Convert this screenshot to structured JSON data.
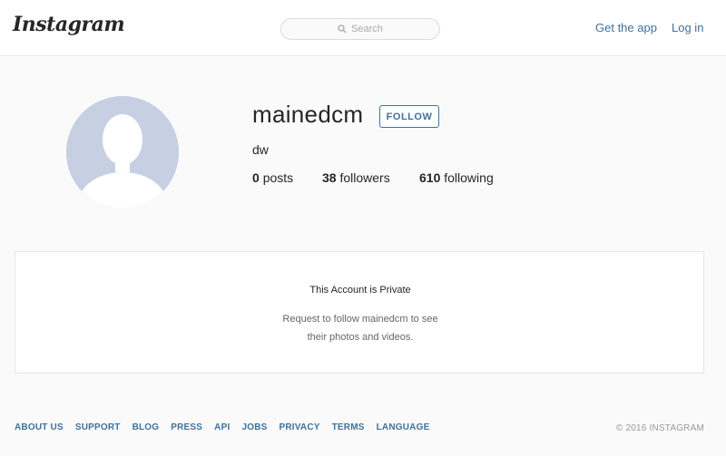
{
  "header": {
    "logo_text": "Instagram",
    "search_placeholder": "Search",
    "get_app_label": "Get the app",
    "login_label": "Log in"
  },
  "profile": {
    "username": "mainedcm",
    "follow_label": "FOLLOW",
    "full_name": "dw",
    "stats": {
      "posts_count": "0",
      "posts_label": "posts",
      "followers_count": "38",
      "followers_label": "followers",
      "following_count": "610",
      "following_label": "following"
    }
  },
  "private_notice": {
    "title": "This Account is Private",
    "line1": "Request to follow mainedcm to see",
    "line2": "their photos and videos."
  },
  "footer": {
    "links": [
      "ABOUT US",
      "SUPPORT",
      "BLOG",
      "PRESS",
      "API",
      "JOBS",
      "PRIVACY",
      "TERMS",
      "LANGUAGE"
    ],
    "copyright": "© 2016 INSTAGRAM"
  },
  "colors": {
    "link_blue": "#3f729b",
    "avatar_bg": "#c7d0e2",
    "page_bg": "#fafafa"
  }
}
